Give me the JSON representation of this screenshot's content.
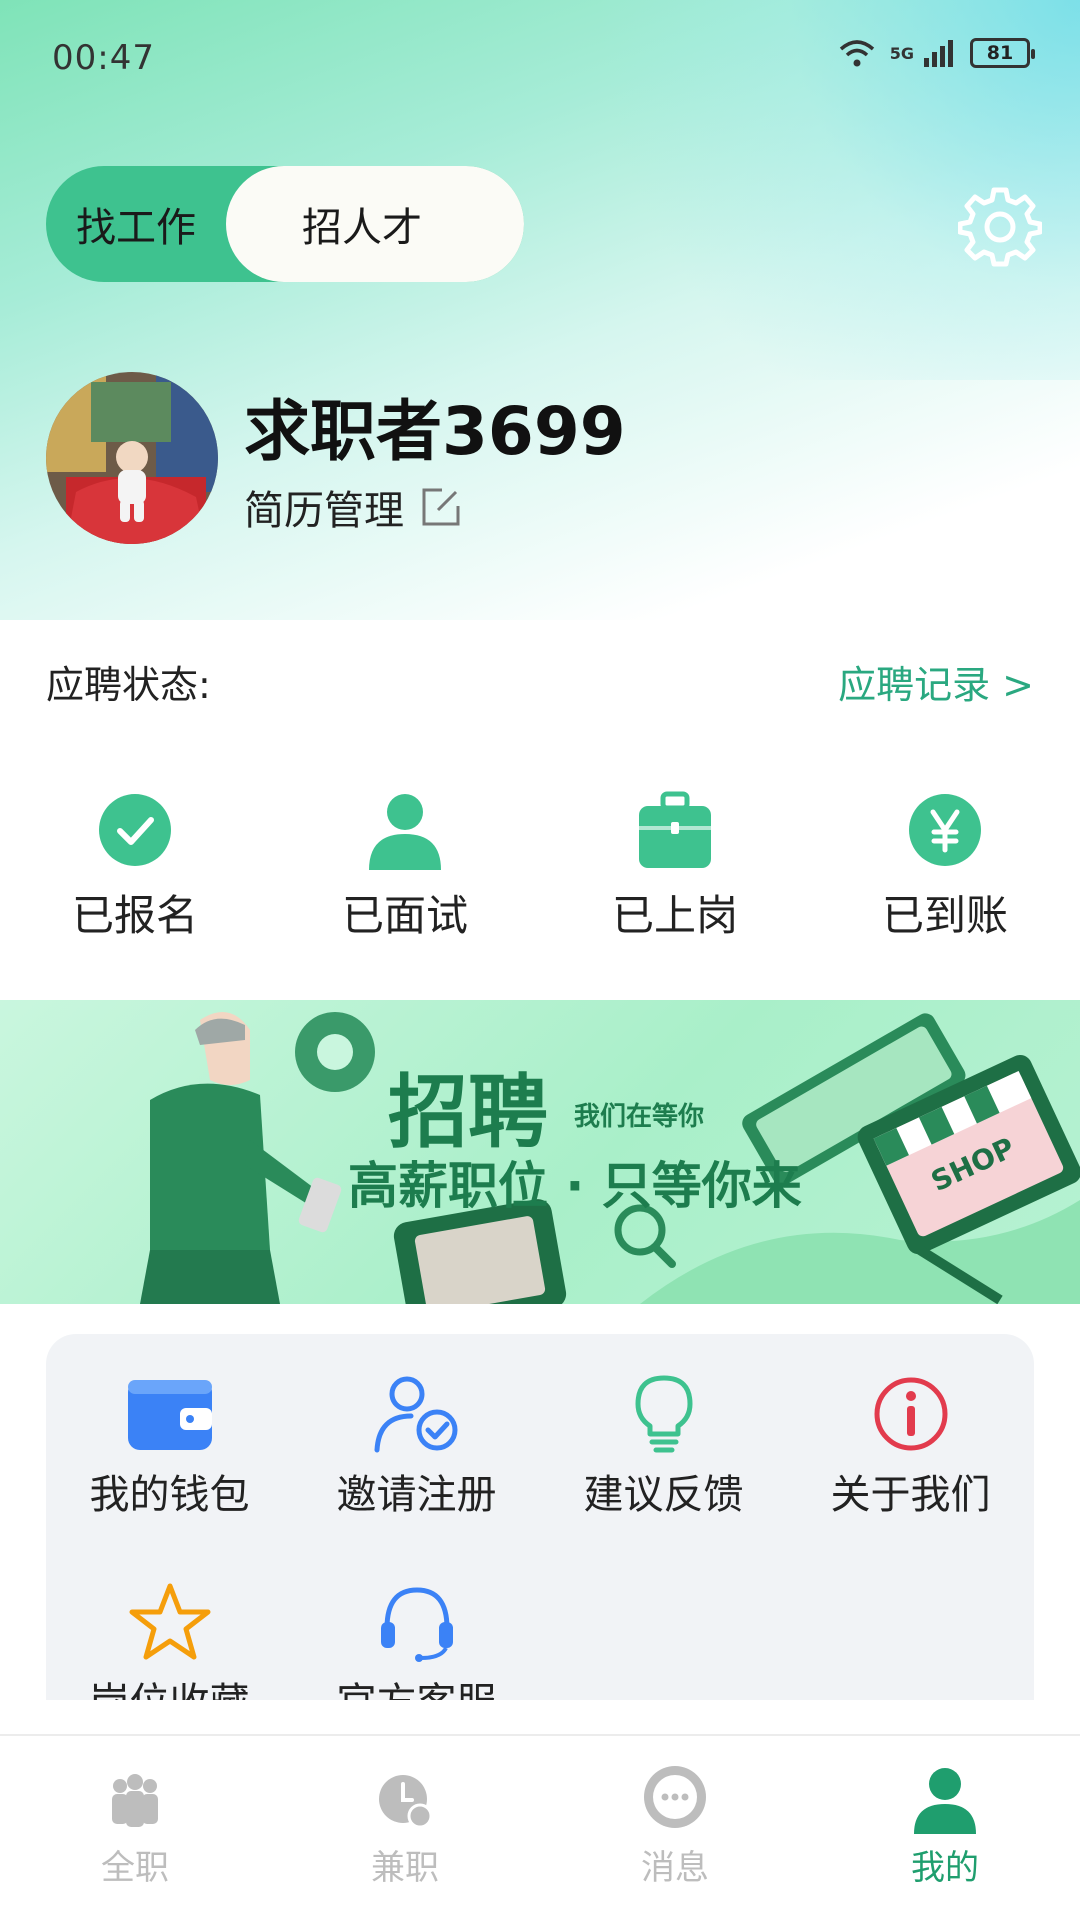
{
  "status_bar": {
    "time": "00:47",
    "network": "5G",
    "battery": "81"
  },
  "role_toggle": {
    "active": "找工作",
    "inactive": "招人才"
  },
  "profile": {
    "name": "求职者3699",
    "resume": "简历管理"
  },
  "application": {
    "label": "应聘状态:",
    "record_link": "应聘记录 >",
    "items": [
      {
        "label": "已报名",
        "icon": "check-circle-icon"
      },
      {
        "label": "已面试",
        "icon": "person-icon"
      },
      {
        "label": "已上岗",
        "icon": "briefcase-icon"
      },
      {
        "label": "已到账",
        "icon": "yen-circle-icon"
      }
    ]
  },
  "banner": {
    "title": "招聘",
    "subtitle": "我们在等你",
    "tagline": "高薪职位 · 只等你来",
    "sign": "SHOP"
  },
  "menu": {
    "items": [
      {
        "label": "我的钱包",
        "icon": "wallet-icon"
      },
      {
        "label": "邀请注册",
        "icon": "invite-user-icon"
      },
      {
        "label": "建议反馈",
        "icon": "lightbulb-icon"
      },
      {
        "label": "关于我们",
        "icon": "info-icon"
      },
      {
        "label": "岗位收藏",
        "icon": "star-icon"
      },
      {
        "label": "官方客服",
        "icon": "headset-icon"
      }
    ]
  },
  "tabs": [
    {
      "label": "全职",
      "icon": "group-icon"
    },
    {
      "label": "兼职",
      "icon": "clock-coin-icon"
    },
    {
      "label": "消息",
      "icon": "chat-icon"
    },
    {
      "label": "我的",
      "icon": "profile-icon",
      "active": true
    }
  ],
  "colors": {
    "accent": "#3ec28f",
    "link": "#2aa880",
    "active_tab": "#1f9e6e"
  }
}
